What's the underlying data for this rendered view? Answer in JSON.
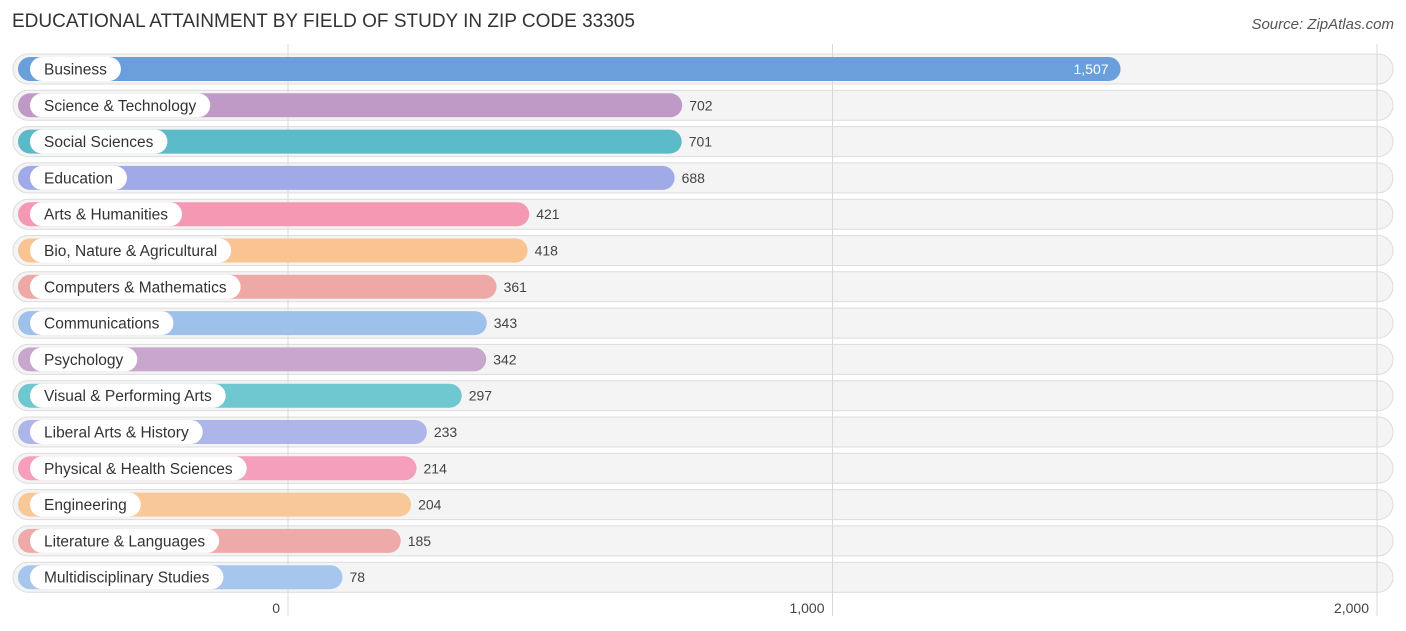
{
  "title": "EDUCATIONAL ATTAINMENT BY FIELD OF STUDY IN ZIP CODE 33305",
  "source": "Source: ZipAtlas.com",
  "chart_data": {
    "type": "bar",
    "orientation": "horizontal",
    "title": "EDUCATIONAL ATTAINMENT BY FIELD OF STUDY IN ZIP CODE 33305",
    "xlabel": "",
    "ylabel": "",
    "xlim": [
      0,
      2000
    ],
    "grid": true,
    "x_ticks": [
      0,
      1000,
      2000
    ],
    "x_tick_labels": [
      "0",
      "1,000",
      "2,000"
    ],
    "categories": [
      "Business",
      "Science & Technology",
      "Social Sciences",
      "Education",
      "Arts & Humanities",
      "Bio, Nature & Agricultural",
      "Computers & Mathematics",
      "Communications",
      "Psychology",
      "Visual & Performing Arts",
      "Liberal Arts & History",
      "Physical & Health Sciences",
      "Engineering",
      "Literature & Languages",
      "Multidisciplinary Studies"
    ],
    "values": [
      1507,
      702,
      701,
      688,
      421,
      418,
      361,
      343,
      342,
      297,
      233,
      214,
      204,
      185,
      78
    ],
    "value_labels": [
      "1,507",
      "702",
      "701",
      "688",
      "421",
      "418",
      "361",
      "343",
      "342",
      "297",
      "233",
      "214",
      "204",
      "185",
      "78"
    ],
    "colors": [
      "#6a9fdb",
      "#c09ac6",
      "#5bbac8",
      "#a0aae6",
      "#f598b4",
      "#f9c492",
      "#eea9a7",
      "#9dc1ea",
      "#c7a8cc",
      "#6fc7cf",
      "#aeb5e8",
      "#f59fbd",
      "#f9c899",
      "#eeaaa8",
      "#a7c6ee"
    ]
  }
}
